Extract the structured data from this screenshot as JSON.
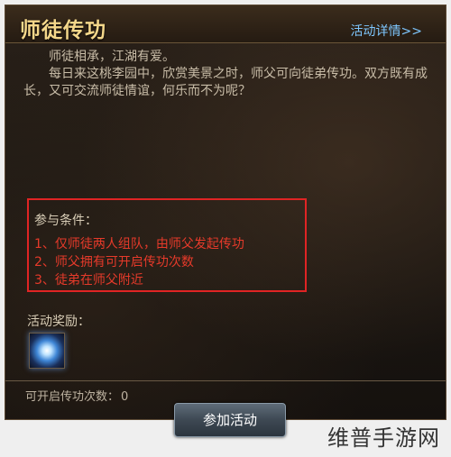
{
  "header": {
    "title": "师徒传功",
    "details_link": "活动详情>>"
  },
  "intro": {
    "line1": "师徒相承，江湖有爱。",
    "line2": "每日来这桃李园中，欣赏美景之时，师父可向徒弟传功。双方既有成长，又可交流师徒情谊，何乐而不为呢？"
  },
  "conditions": {
    "heading": "参与条件：",
    "items": [
      "1、仅师徒两人组队，由师父发起传功",
      "2、师父拥有可开启传功次数",
      "3、徒弟在师父附近"
    ],
    "highlight_color": "#e02424"
  },
  "rewards": {
    "heading": "活动奖励：",
    "icon": "glowing-orb-icon"
  },
  "footer": {
    "count_label": "可开启传功次数：",
    "count_value": "0",
    "join_button": "参加活动"
  },
  "watermark": "维普手游网"
}
